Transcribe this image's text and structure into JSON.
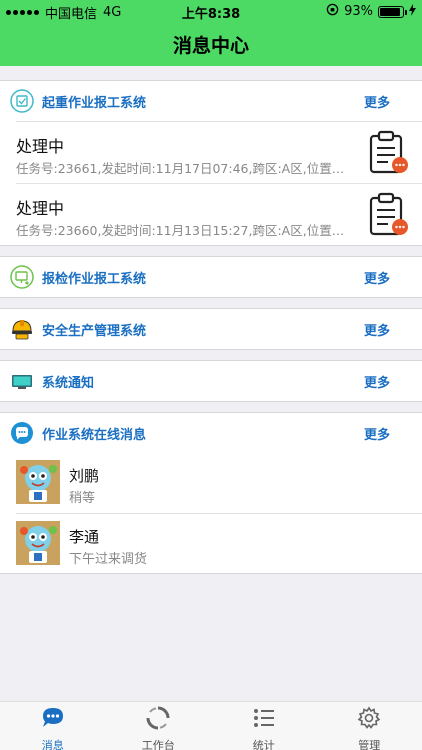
{
  "status_bar": {
    "carrier": "中国电信",
    "network": "4G",
    "time": "上午8:38",
    "battery": "93%"
  },
  "nav": {
    "title": "消息中心"
  },
  "colors": {
    "header_green": "#4cd964",
    "accent_blue": "#1a6fc2",
    "badge_orange": "#e8572a"
  },
  "sections": {
    "lifting": {
      "title": "起重作业报工系统",
      "more": "更多",
      "tasks": [
        {
          "status": "处理中",
          "detail": "任务号:23661,发起时间:11月17日07:46,跨区:A区,位置:..."
        },
        {
          "status": "处理中",
          "detail": "任务号:23660,发起时间:11月13日15:27,跨区:A区,位置:..."
        }
      ]
    },
    "inspection": {
      "title": "报检作业报工系统",
      "more": "更多"
    },
    "safety": {
      "title": "安全生产管理系统",
      "more": "更多"
    },
    "notice": {
      "title": "系统通知",
      "more": "更多"
    },
    "online": {
      "title": "作业系统在线消息",
      "more": "更多",
      "chats": [
        {
          "name": "刘鹏",
          "message": "稍等"
        },
        {
          "name": "李通",
          "message": "下午过来调货"
        }
      ]
    }
  },
  "tabs": [
    {
      "label": "消息",
      "icon": "chat-bubble-icon",
      "active": true
    },
    {
      "label": "工作台",
      "icon": "refresh-circle-icon",
      "active": false
    },
    {
      "label": "统计",
      "icon": "list-icon",
      "active": false
    },
    {
      "label": "管理",
      "icon": "gear-icon",
      "active": false
    }
  ]
}
